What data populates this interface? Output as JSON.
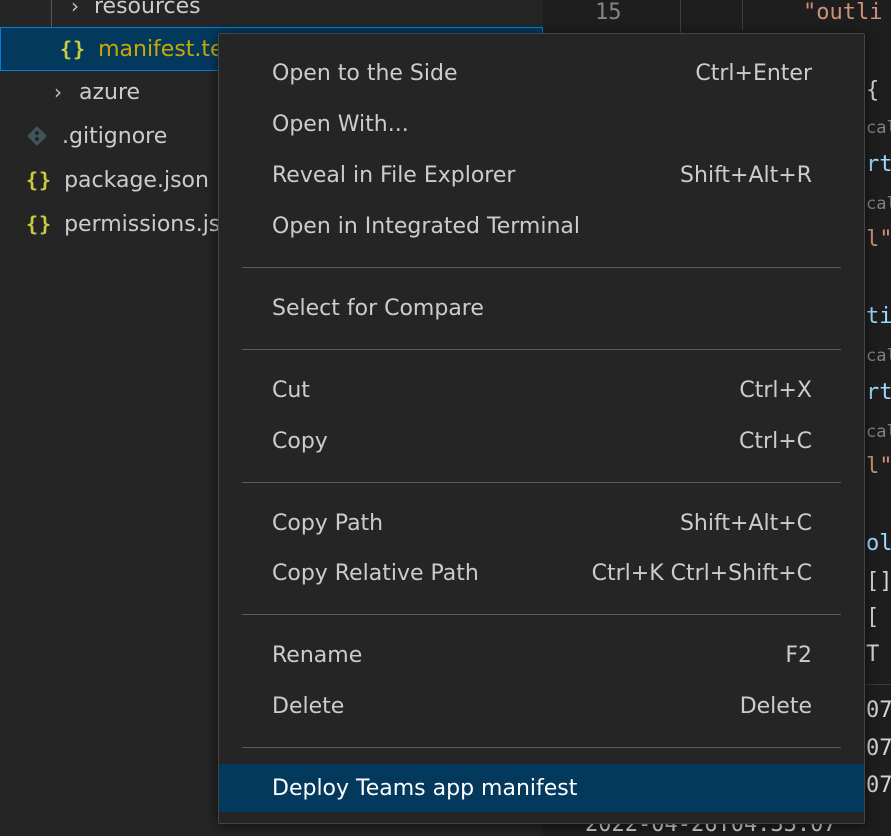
{
  "explorer": {
    "items": [
      {
        "label": "resources",
        "type": "folder"
      },
      {
        "label": "manifest.te",
        "type": "json",
        "selected": true
      },
      {
        "label": "azure",
        "type": "folder"
      },
      {
        "label": ".gitignore",
        "type": "git"
      },
      {
        "label": "package.json",
        "type": "json"
      },
      {
        "label": "permissions.js",
        "type": "json"
      }
    ],
    "json_icon_glyph": "{}",
    "chevron_glyph": "›"
  },
  "editor": {
    "line_number": "15",
    "fragments": [
      "\"outli",
      "{",
      "cal",
      "rt",
      "cal",
      "l\"",
      "ti",
      "cal",
      "rt",
      "cal",
      "l\"",
      "ol",
      "[]",
      "[",
      "T",
      "07",
      "07",
      "07",
      "2022-04-26T04:33:07"
    ]
  },
  "context_menu": {
    "groups": [
      [
        {
          "label": "Open to the Side",
          "shortcut": "Ctrl+Enter"
        },
        {
          "label": "Open With...",
          "shortcut": ""
        },
        {
          "label": "Reveal in File Explorer",
          "shortcut": "Shift+Alt+R"
        },
        {
          "label": "Open in Integrated Terminal",
          "shortcut": ""
        }
      ],
      [
        {
          "label": "Select for Compare",
          "shortcut": ""
        }
      ],
      [
        {
          "label": "Cut",
          "shortcut": "Ctrl+X"
        },
        {
          "label": "Copy",
          "shortcut": "Ctrl+C"
        }
      ],
      [
        {
          "label": "Copy Path",
          "shortcut": "Shift+Alt+C"
        },
        {
          "label": "Copy Relative Path",
          "shortcut": "Ctrl+K Ctrl+Shift+C"
        }
      ],
      [
        {
          "label": "Rename",
          "shortcut": "F2"
        },
        {
          "label": "Delete",
          "shortcut": "Delete"
        }
      ],
      [
        {
          "label": "Deploy Teams app manifest",
          "shortcut": "",
          "active": true
        }
      ]
    ]
  },
  "colors": {
    "selection_bg": "#04395e",
    "json_icon": "#cbcb41",
    "selected_file_text": "#cca700"
  }
}
